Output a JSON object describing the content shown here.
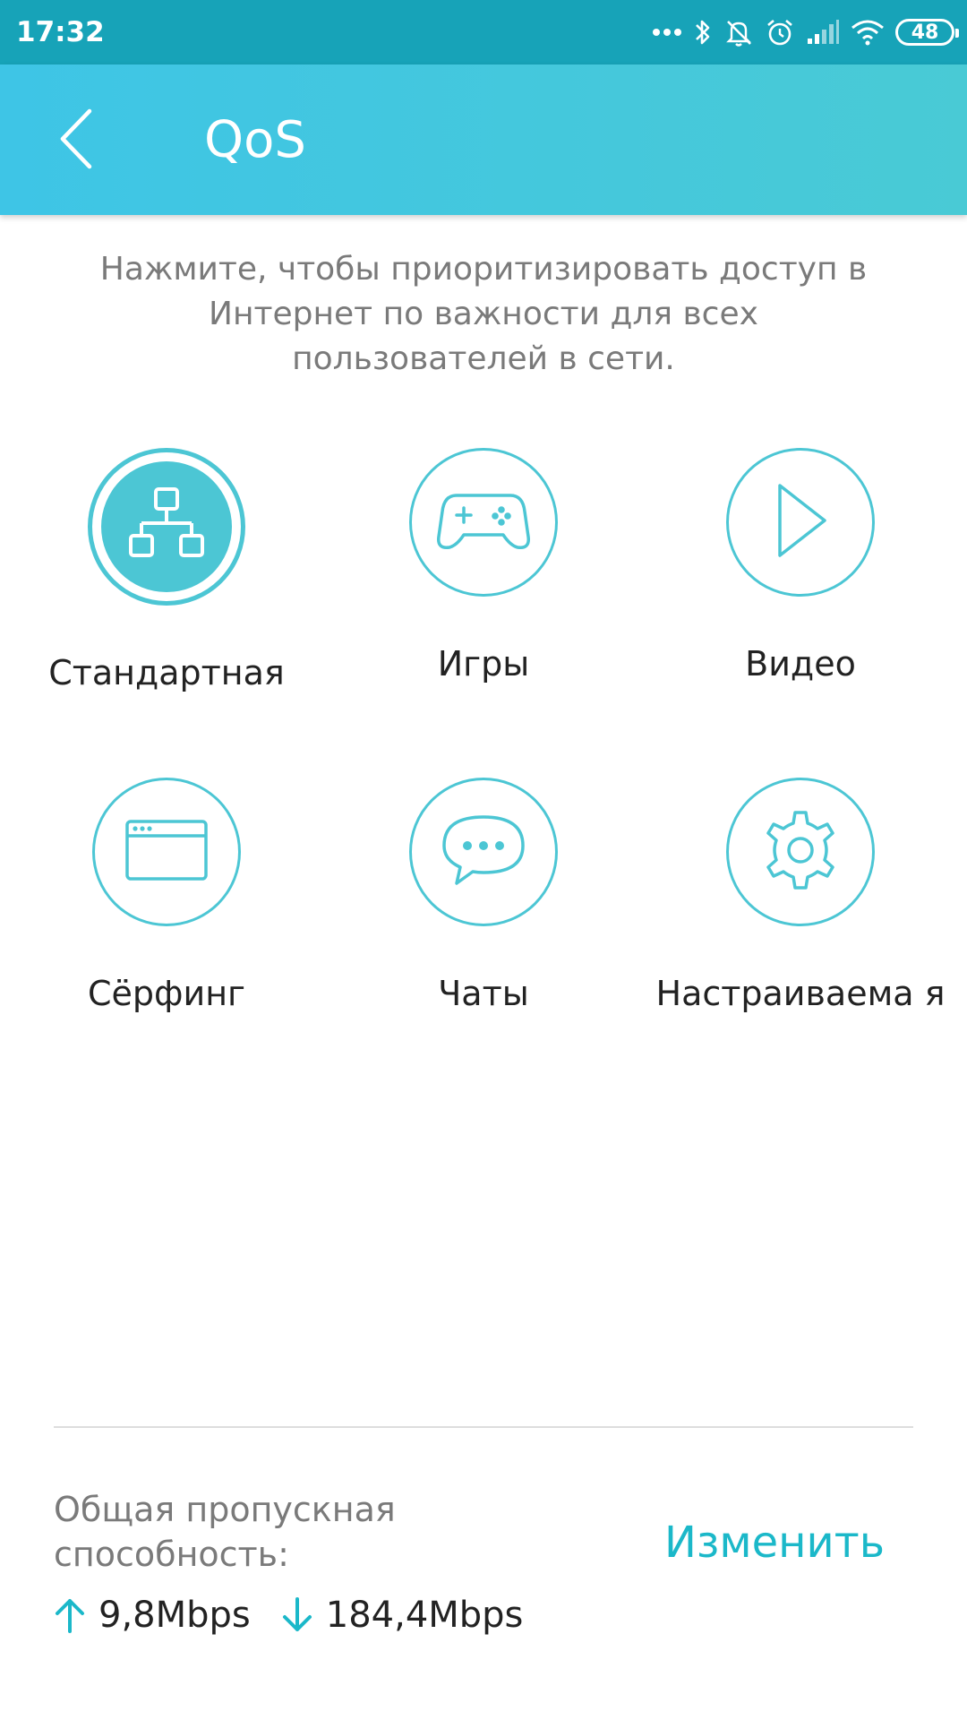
{
  "status_bar": {
    "time": "17:32",
    "battery": "48",
    "icons": [
      "more-dots-icon",
      "bluetooth-icon",
      "silent-icon",
      "alarm-icon",
      "signal-icon",
      "wifi-icon",
      "battery-icon"
    ]
  },
  "header": {
    "title": "QoS",
    "back_icon": "chevron-left-icon"
  },
  "description": "Нажмите, чтобы приоритизировать доступ в Интернет по важности для всех пользователей в сети.",
  "modes": [
    {
      "label": "Стандартная",
      "icon": "network-tree-icon",
      "selected": true
    },
    {
      "label": "Игры",
      "icon": "gamepad-icon",
      "selected": false
    },
    {
      "label": "Видео",
      "icon": "play-icon",
      "selected": false
    },
    {
      "label": "Сёрфинг",
      "icon": "browser-window-icon",
      "selected": false
    },
    {
      "label": "Чаты",
      "icon": "chat-bubble-icon",
      "selected": false
    },
    {
      "label": "Настраиваема я",
      "icon": "gear-icon",
      "selected": false
    }
  ],
  "bandwidth": {
    "label": "Общая пропускная способность:",
    "change_label": "Изменить",
    "upload": "9,8Mbps",
    "download": "184,4Mbps"
  },
  "colors": {
    "status_bar": "#17a3b8",
    "header": "#3ec5e6",
    "accent": "#4cc6d4",
    "link": "#1bb8c9"
  }
}
